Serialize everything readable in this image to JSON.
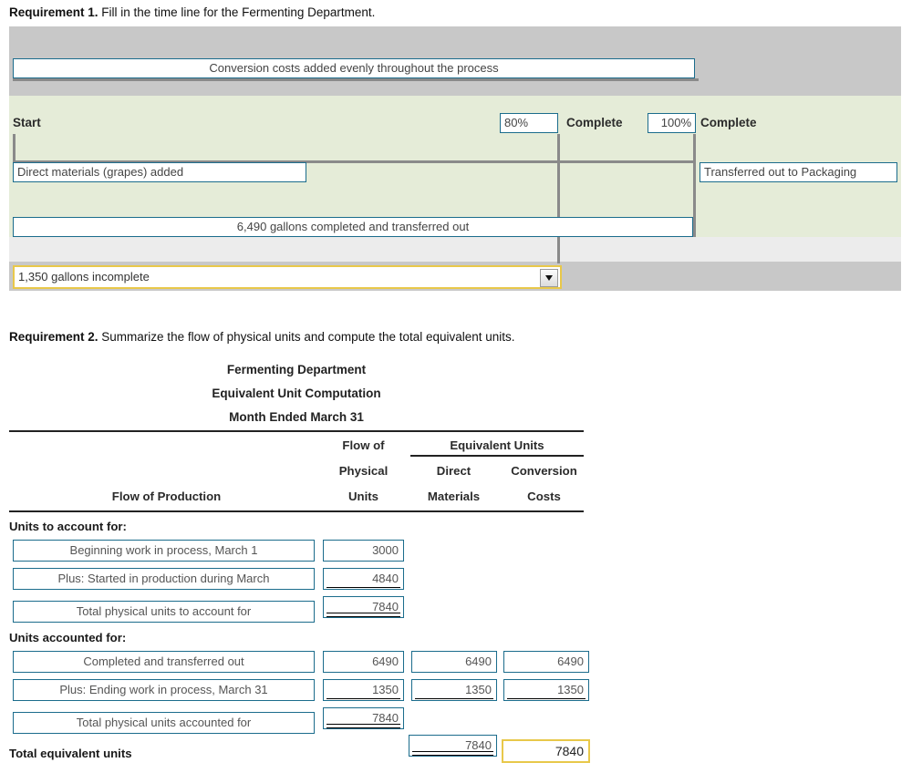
{
  "requirement1": {
    "label": "Requirement 1.",
    "text": "Fill in the time line for the Fermenting Department."
  },
  "requirement2": {
    "label": "Requirement 2.",
    "text": "Summarize the flow of physical units and compute the total equivalent units."
  },
  "timeline": {
    "conversion_bar": "Conversion costs added evenly throughout the process",
    "start_label": "Start",
    "pct_80": "80%",
    "complete_80": "Complete",
    "pct_100": "100%",
    "complete_100": "Complete",
    "direct_materials": "Direct materials (grapes) added",
    "transferred_out": "Transferred out to Packaging",
    "completed_bar": "6,490 gallons completed and transferred out",
    "incomplete_dropdown": "1,350 gallons incomplete",
    "dropdown_icon": "chevron-down-icon"
  },
  "table": {
    "title_line1": "Fermenting Department",
    "title_line2": "Equivalent Unit Computation",
    "title_line3": "Month Ended March 31",
    "headers": {
      "flow_of_production": "Flow of Production",
      "flow_of": "Flow of",
      "physical": "Physical",
      "units": "Units",
      "equivalent_units": "Equivalent Units",
      "direct": "Direct",
      "materials": "Materials",
      "conversion": "Conversion",
      "costs": "Costs"
    },
    "section1_head": "Units to account for:",
    "section2_head": "Units accounted for:",
    "total_equivalent_units_label": "Total equivalent units",
    "rows": [
      {
        "label": "Beginning work in process, March 1",
        "physical": "3000",
        "direct_materials": "",
        "conversion": ""
      },
      {
        "label": "Plus: Started in production during March",
        "physical": "4840",
        "direct_materials": "",
        "conversion": ""
      },
      {
        "label": "Total physical units to account for",
        "physical": "7840",
        "direct_materials": "",
        "conversion": ""
      },
      {
        "label": "Completed and transferred out",
        "physical": "6490",
        "direct_materials": "6490",
        "conversion": "6490"
      },
      {
        "label": "Plus: Ending work in process, March 31",
        "physical": "1350",
        "direct_materials": "1350",
        "conversion": "1350"
      },
      {
        "label": "Total physical units accounted for",
        "physical": "7840",
        "direct_materials": "",
        "conversion": ""
      }
    ],
    "totals": {
      "direct_materials": "7840",
      "conversion": "7840"
    }
  },
  "colors": {
    "panel_gray": "#c8c8c8",
    "band_green": "#e5ecd8",
    "band_light": "#ececec",
    "box_border": "#1b6c8c",
    "active_border": "#e8c84a",
    "rule_gray": "#8a8a8a"
  }
}
